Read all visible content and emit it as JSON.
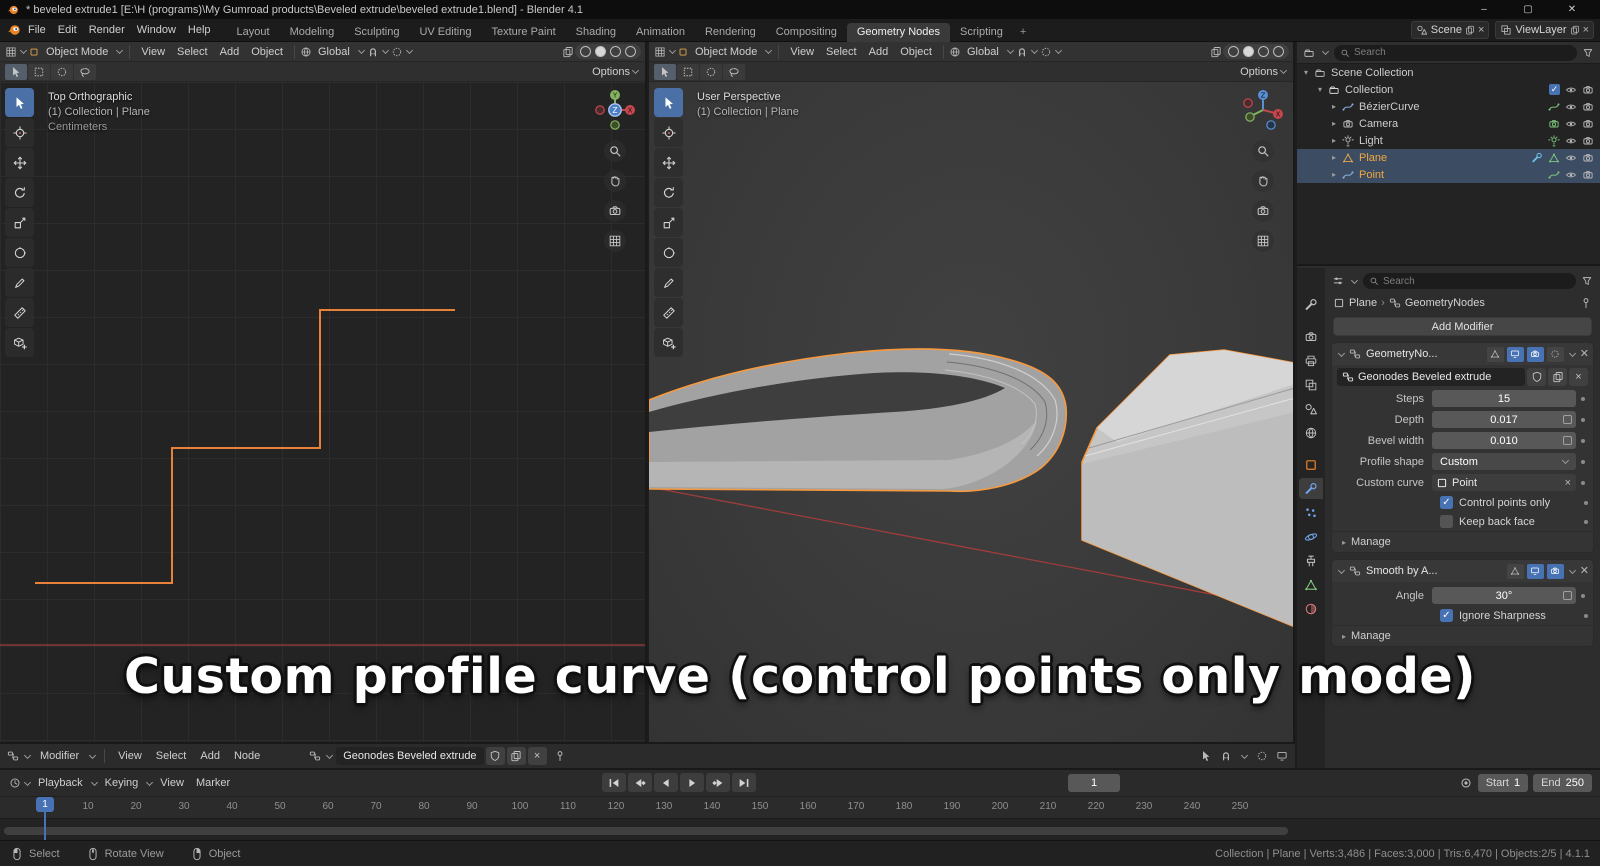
{
  "window": {
    "title": "* beveled extrude1 [E:\\H (programs)\\My Gumroad products\\Beveled extrude\\beveled extrude1.blend] - Blender 4.1",
    "minimize": "–",
    "maximize": "▢",
    "close": "✕"
  },
  "topbar": {
    "menus": [
      "File",
      "Edit",
      "Render",
      "Window",
      "Help"
    ],
    "tabs": [
      "Layout",
      "Modeling",
      "Sculpting",
      "UV Editing",
      "Texture Paint",
      "Shading",
      "Animation",
      "Rendering",
      "Compositing",
      "Geometry Nodes",
      "Scripting"
    ],
    "active_tab": "Geometry Nodes",
    "add_tab": "+",
    "scene_label": "Scene",
    "viewlayer_label": "ViewLayer"
  },
  "viewport_left": {
    "mode": "Object Mode",
    "menus": [
      "View",
      "Select",
      "Add",
      "Object"
    ],
    "orientation": "Global",
    "options_label": "Options",
    "overlay": [
      "Top Orthographic",
      "(1) Collection | Plane",
      "Centimeters"
    ]
  },
  "viewport_right": {
    "mode": "Object Mode",
    "menus": [
      "View",
      "Select",
      "Add",
      "Object"
    ],
    "orientation": "Global",
    "options_label": "Options",
    "overlay": [
      "User Perspective",
      "(1) Collection | Plane"
    ]
  },
  "tools": [
    "select-box",
    "cursor",
    "move",
    "rotate",
    "scale",
    "transform",
    "annotate",
    "measure",
    "add-cube"
  ],
  "outliner": {
    "search_placeholder": "Search",
    "items": [
      {
        "label": "Scene Collection"
      },
      {
        "label": "Collection"
      },
      {
        "label": "BézierCurve"
      },
      {
        "label": "Camera"
      },
      {
        "label": "Light"
      },
      {
        "label": "Plane"
      },
      {
        "label": "Point"
      }
    ]
  },
  "properties": {
    "search_placeholder": "Search",
    "breadcrumb_object": "Plane",
    "breadcrumb_data": "GeometryNodes",
    "add_modifier_label": "Add Modifier",
    "modifier1": {
      "name": "GeometryNo...",
      "node_group": "Geonodes Beveled extrude",
      "steps_label": "Steps",
      "steps_value": "15",
      "depth_label": "Depth",
      "depth_value": "0.017",
      "bevel_label": "Bevel width",
      "bevel_value": "0.010",
      "profile_label": "Profile shape",
      "profile_value": "Custom",
      "curve_label": "Custom curve",
      "curve_value": "Point",
      "cb1_label": "Control points only",
      "cb1_checked": true,
      "cb2_label": "Keep back face",
      "cb2_checked": false,
      "manage_label": "Manage"
    },
    "modifier2": {
      "name": "Smooth by A...",
      "angle_label": "Angle",
      "angle_value": "30°",
      "cb1_label": "Ignore Sharpness",
      "cb1_checked": true,
      "manage_label": "Manage"
    }
  },
  "node_editor": {
    "mode": "Modifier",
    "menus": [
      "View",
      "Select",
      "Add",
      "Node"
    ],
    "node_group": "Geonodes Beveled extrude"
  },
  "timeline": {
    "playback": "Playback",
    "keying": "Keying",
    "view": "View",
    "marker": "Marker",
    "current_frame": "1",
    "playhead_frame": "1",
    "start_label": "Start",
    "start_value": "1",
    "end_label": "End",
    "end_value": "250",
    "ruler": [
      "10",
      "20",
      "30",
      "40",
      "50",
      "60",
      "70",
      "80",
      "90",
      "100",
      "110",
      "120",
      "130",
      "140",
      "150",
      "160",
      "170",
      "180",
      "190",
      "200",
      "210",
      "220",
      "230",
      "240",
      "250"
    ]
  },
  "statusbar": {
    "hints": [
      {
        "label": "Select"
      },
      {
        "label": "Rotate View"
      },
      {
        "label": "Object"
      }
    ],
    "stats": "Collection | Plane | Verts:3,486 | Faces:3,000 | Tris:6,470 | Objects:2/5 | 4.1.1"
  },
  "caption": "Custom profile curve (control points only mode)",
  "colors": {
    "accent_orange": "#e8832a",
    "selection_blue": "#4772b3",
    "outline_orange": "#f7993f",
    "axis_red": "#a03c3c"
  }
}
